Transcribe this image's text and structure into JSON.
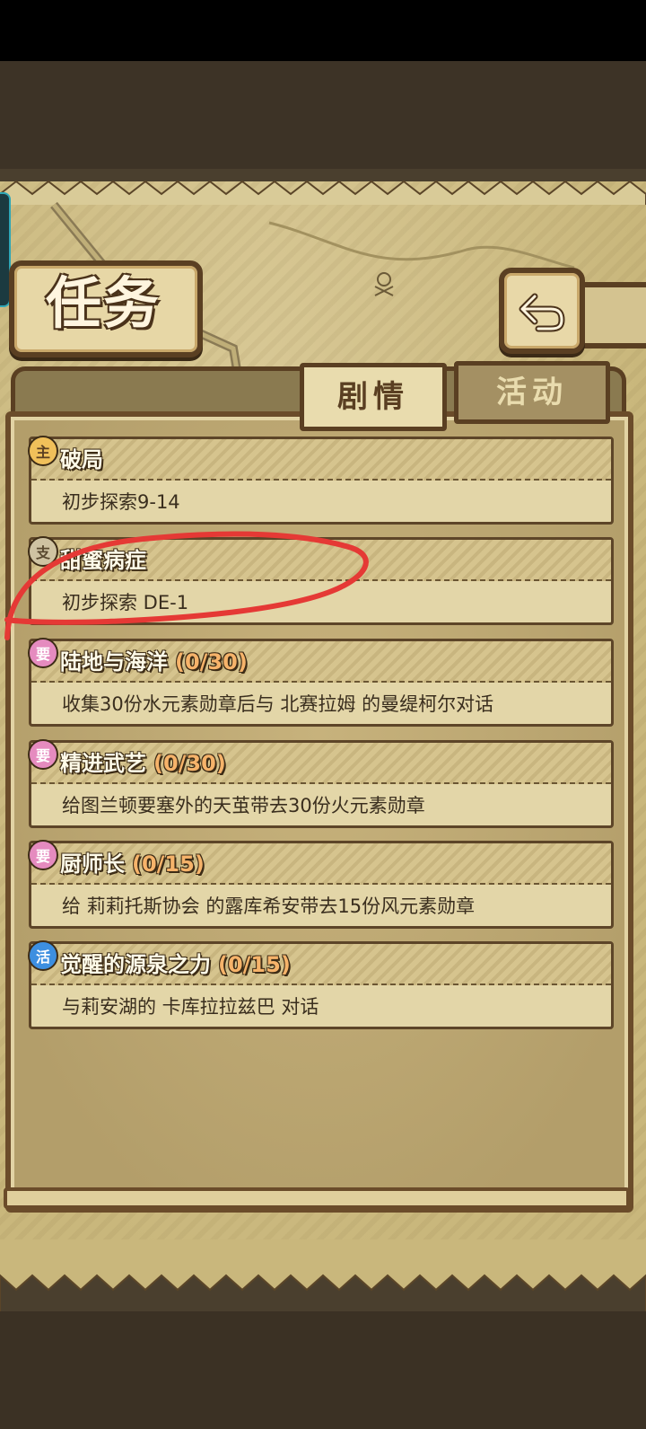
{
  "screen": {
    "title": "任务"
  },
  "tabs": [
    {
      "label": "剧情",
      "active": true
    },
    {
      "label": "活动",
      "active": false
    }
  ],
  "quests": [
    {
      "badge": "主",
      "badge_type": "main",
      "title": "破局",
      "count": "",
      "desc": "初步探索9-14"
    },
    {
      "badge": "支",
      "badge_type": "sub",
      "title": "甜蜜病症",
      "count": "",
      "desc": "初步探索 DE-1"
    },
    {
      "badge": "要",
      "badge_type": "req",
      "title": "陆地与海洋",
      "count": "(0/30)",
      "desc": "收集30份水元素勋章后与 北赛拉姆 的曼缇柯尔对话"
    },
    {
      "badge": "要",
      "badge_type": "req",
      "title": "精进武艺",
      "count": "(0/30)",
      "desc": "给图兰顿要塞外的天茧带去30份火元素勋章"
    },
    {
      "badge": "要",
      "badge_type": "req",
      "title": "厨师长",
      "count": "(0/15)",
      "desc": "给 莉莉托斯协会 的露库希安带去15份风元素勋章"
    },
    {
      "badge": "活",
      "badge_type": "act",
      "title": "觉醒的源泉之力",
      "count": "(0/15)",
      "desc": "与莉安湖的 卡库拉拉兹巴 对话"
    }
  ],
  "colors": {
    "annotation": "#e53935",
    "frame": "#5a3f22",
    "parchment": "#c9b77c"
  },
  "icons": [
    "back-arrow-icon",
    "skull-icon"
  ]
}
